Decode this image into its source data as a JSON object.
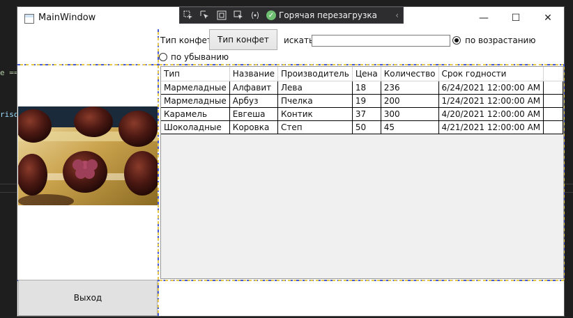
{
  "ide": {
    "code_line_1": "e ==",
    "code_line_2": "riso"
  },
  "window": {
    "title": "MainWindow",
    "minimize_glyph": "—",
    "maximize_glyph": "☐",
    "close_glyph": "✕"
  },
  "hot_reload": {
    "label": "Горячая перезагрузка",
    "check_glyph": "✓",
    "collapse_glyph": "‹"
  },
  "filter": {
    "type_label": "Тип конфет:",
    "type_combo_value": "Тип конфет",
    "combo_arrow": "⌄",
    "search_label": "искать",
    "search_value": "",
    "ascending_label": "по возрастанию",
    "descending_label": "по убыванию",
    "ascending_selected": true
  },
  "grid": {
    "columns": [
      "Тип",
      "Название",
      "Производитель",
      "Цена",
      "Количество",
      "Срок годности"
    ],
    "rows": [
      [
        "Мармеладные",
        "Алфавит",
        "Лева",
        "18",
        "236",
        "6/24/2021 12:00:00 AM"
      ],
      [
        "Мармеладные",
        "Арбуз",
        "Пчелка",
        "19",
        "200",
        "1/24/2021 12:00:00 AM"
      ],
      [
        "Карамель",
        "Евгеша",
        "Контик",
        "37",
        "300",
        "4/20/2021 12:00:00 AM"
      ],
      [
        "Шоколадные",
        "Коровка",
        "Степ",
        "50",
        "45",
        "4/21/2021 12:00:00 AM"
      ]
    ]
  },
  "exit_button": {
    "label": "Выход"
  },
  "colors": {
    "accent_dash_blue": "#4a5bd6",
    "accent_dash_yellow": "#e6c84a",
    "hot_reload_check": "#6fbf73"
  }
}
